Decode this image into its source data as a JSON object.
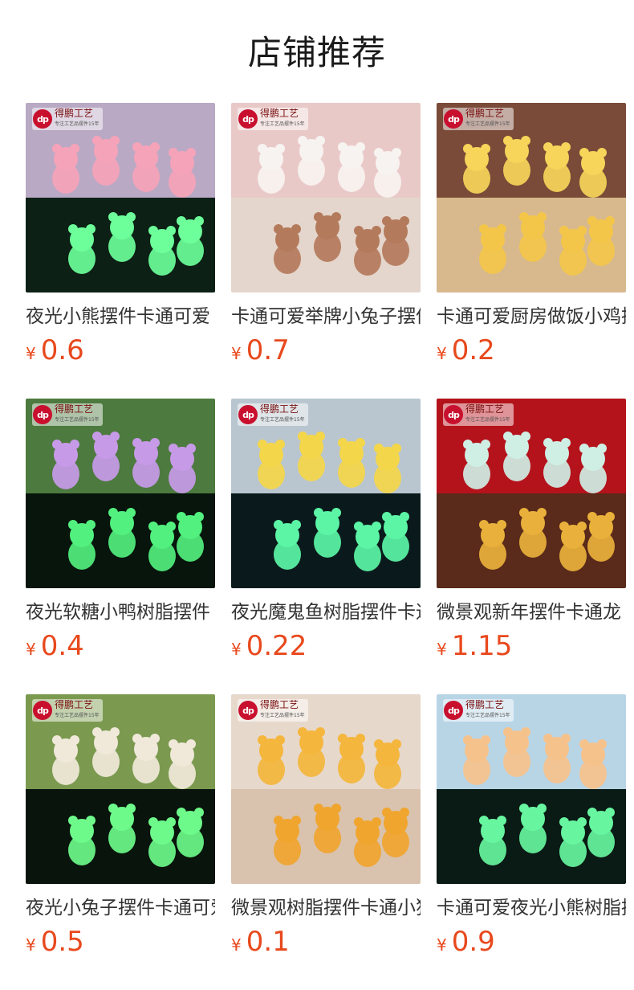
{
  "header": {
    "title": "店铺推荐"
  },
  "brand": {
    "logo_mark": "dp",
    "logo_text": "得鹏工艺",
    "logo_subtext": "专注工艺品摆件15年"
  },
  "products": [
    {
      "name": "夜光小熊摆件卡通可爱",
      "currency": "¥",
      "price": "0.6",
      "image": "glow-bear-figurines",
      "colors": {
        "top": "#b9a9c4",
        "bottom": "#0c2015",
        "fig_top": "#f5a3b9",
        "fig_bottom": "#6dff9a"
      }
    },
    {
      "name": "卡通可爱举牌小兔子摆件",
      "currency": "¥",
      "price": "0.7",
      "image": "bunny-cat-bear-sign-figurines",
      "colors": {
        "top": "#e9c9c8",
        "bottom": "#e4d6cc",
        "fig_top": "#f7f3f0",
        "fig_bottom": "#b47a5c"
      }
    },
    {
      "name": "卡通可爱厨房做饭小鸡摆件",
      "currency": "¥",
      "price": "0.2",
      "image": "cooking-chick-figurines",
      "colors": {
        "top": "#7a4b38",
        "bottom": "#d8b98e",
        "fig_top": "#f6d55a",
        "fig_bottom": "#f3c64a"
      }
    },
    {
      "name": "夜光软糖小鸭树脂摆件",
      "currency": "¥",
      "price": "0.4",
      "image": "glow-gummy-duck-figurines",
      "colors": {
        "top": "#4d7a3e",
        "bottom": "#07150c",
        "fig_top": "#c79ae8",
        "fig_bottom": "#52f07e"
      }
    },
    {
      "name": "夜光魔鬼鱼树脂摆件卡通",
      "currency": "¥",
      "price": "0.22",
      "image": "glow-manta-ray-figurines",
      "colors": {
        "top": "#b9c6cf",
        "bottom": "#0a1a1c",
        "fig_top": "#f4d64b",
        "fig_bottom": "#5cf5a6"
      }
    },
    {
      "name": "微景观新年摆件卡通龙",
      "currency": "¥",
      "price": "1.15",
      "image": "new-year-dragon-figurines",
      "colors": {
        "top": "#b5131c",
        "bottom": "#5a2a1a",
        "fig_top": "#cfeee4",
        "fig_bottom": "#e9b13b"
      }
    },
    {
      "name": "夜光小兔子摆件卡通可爱",
      "currency": "¥",
      "price": "0.5",
      "image": "glow-rabbit-figurines",
      "colors": {
        "top": "#7b9a4f",
        "bottom": "#08140c",
        "fig_top": "#f0e9da",
        "fig_bottom": "#6dfa8a"
      }
    },
    {
      "name": "微景观树脂摆件卡通小狗",
      "currency": "¥",
      "price": "0.1",
      "image": "yellow-puppy-figurines",
      "colors": {
        "top": "#e7d8cc",
        "bottom": "#d9c3ae",
        "fig_top": "#f4b63c",
        "fig_bottom": "#f0a52e"
      }
    },
    {
      "name": "卡通可爱夜光小熊树脂摆件",
      "currency": "¥",
      "price": "0.9",
      "image": "glow-bear-figurines-2",
      "colors": {
        "top": "#b8d5e6",
        "bottom": "#0a1a14",
        "fig_top": "#f6c28c",
        "fig_bottom": "#67f5a0"
      }
    }
  ]
}
